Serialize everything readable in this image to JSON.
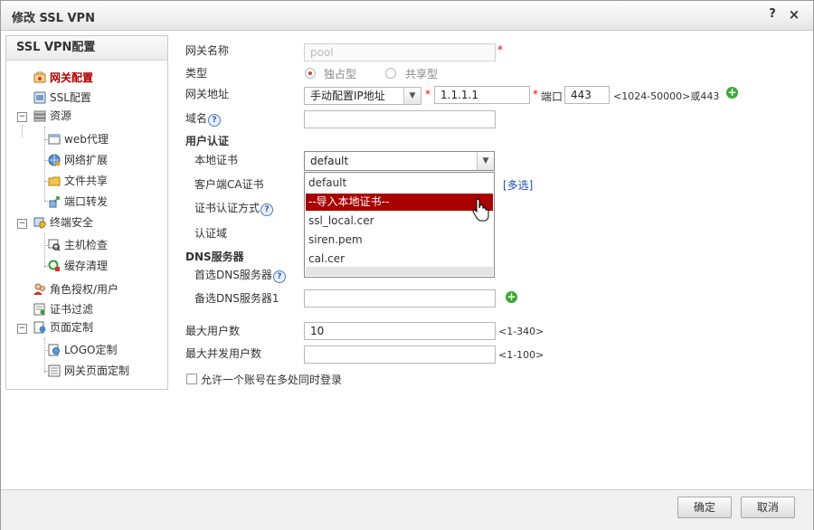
{
  "window": {
    "title": "修改 SSL VPN",
    "help": "?",
    "close": "×"
  },
  "nav": {
    "header": "SSL VPN配置",
    "items": [
      {
        "label": "网关配置",
        "icon": "gateway-config-icon"
      },
      {
        "label": "SSL配置",
        "icon": "ssl-config-icon"
      },
      {
        "label": "资源",
        "icon": "resource-icon"
      },
      {
        "label": "web代理",
        "icon": "web-proxy-icon"
      },
      {
        "label": "网络扩展",
        "icon": "network-extension-icon"
      },
      {
        "label": "文件共享",
        "icon": "file-share-icon"
      },
      {
        "label": "端口转发",
        "icon": "port-forward-icon"
      },
      {
        "label": "终端安全",
        "icon": "endpoint-security-icon"
      },
      {
        "label": "主机检查",
        "icon": "host-check-icon"
      },
      {
        "label": "缓存清理",
        "icon": "cache-clean-icon"
      },
      {
        "label": "角色授权/用户",
        "icon": "role-user-icon"
      },
      {
        "label": "证书过滤",
        "icon": "cert-filter-icon"
      },
      {
        "label": "页面定制",
        "icon": "page-custom-icon"
      },
      {
        "label": "LOGO定制",
        "icon": "logo-custom-icon"
      },
      {
        "label": "网关页面定制",
        "icon": "gateway-page-icon"
      }
    ]
  },
  "form": {
    "gateway_name": {
      "label": "网关名称",
      "value": "pool"
    },
    "type": {
      "label": "类型",
      "option1": "独占型",
      "option2": "共享型",
      "selected": "独占型"
    },
    "gateway_address": {
      "label": "网关地址",
      "mode": "手动配置IP地址",
      "ip": "1.1.1.1",
      "port_label": "端口",
      "port": "443",
      "port_hint": "<1024-50000>或443"
    },
    "domain": {
      "label": "域名",
      "value": ""
    },
    "user_auth": {
      "section": "用户认证",
      "local_cert_label": "本地证书",
      "local_cert_value": "default",
      "client_ca_label": "客户端CA证书",
      "multi_select": "[多选]",
      "cert_auth_label": "证书认证方式",
      "auth_domain_label": "认证域"
    },
    "dns": {
      "section": "DNS服务器",
      "primary_label": "首选DNS服务器",
      "secondary_label": "备选DNS服务器1",
      "secondary_value": ""
    },
    "max_users": {
      "label": "最大用户数",
      "value": "10",
      "hint": "<1-340>"
    },
    "max_concurrent": {
      "label": "最大并发用户数",
      "value": "",
      "hint": "<1-100>"
    },
    "multi_login": {
      "label": "允许一个账号在多处同时登录",
      "checked": false
    }
  },
  "dropdown": {
    "options": [
      "default",
      "--导入本地证书--",
      "ssl_local.cer",
      "siren.pem",
      "cal.cer"
    ],
    "highlighted": "--导入本地证书--"
  },
  "footer": {
    "ok": "确定",
    "cancel": "取消"
  },
  "colors": {
    "accent": "#a80000",
    "active_nav": "#b00000",
    "required": "#ee0000",
    "add_green": "#3aaa35"
  }
}
